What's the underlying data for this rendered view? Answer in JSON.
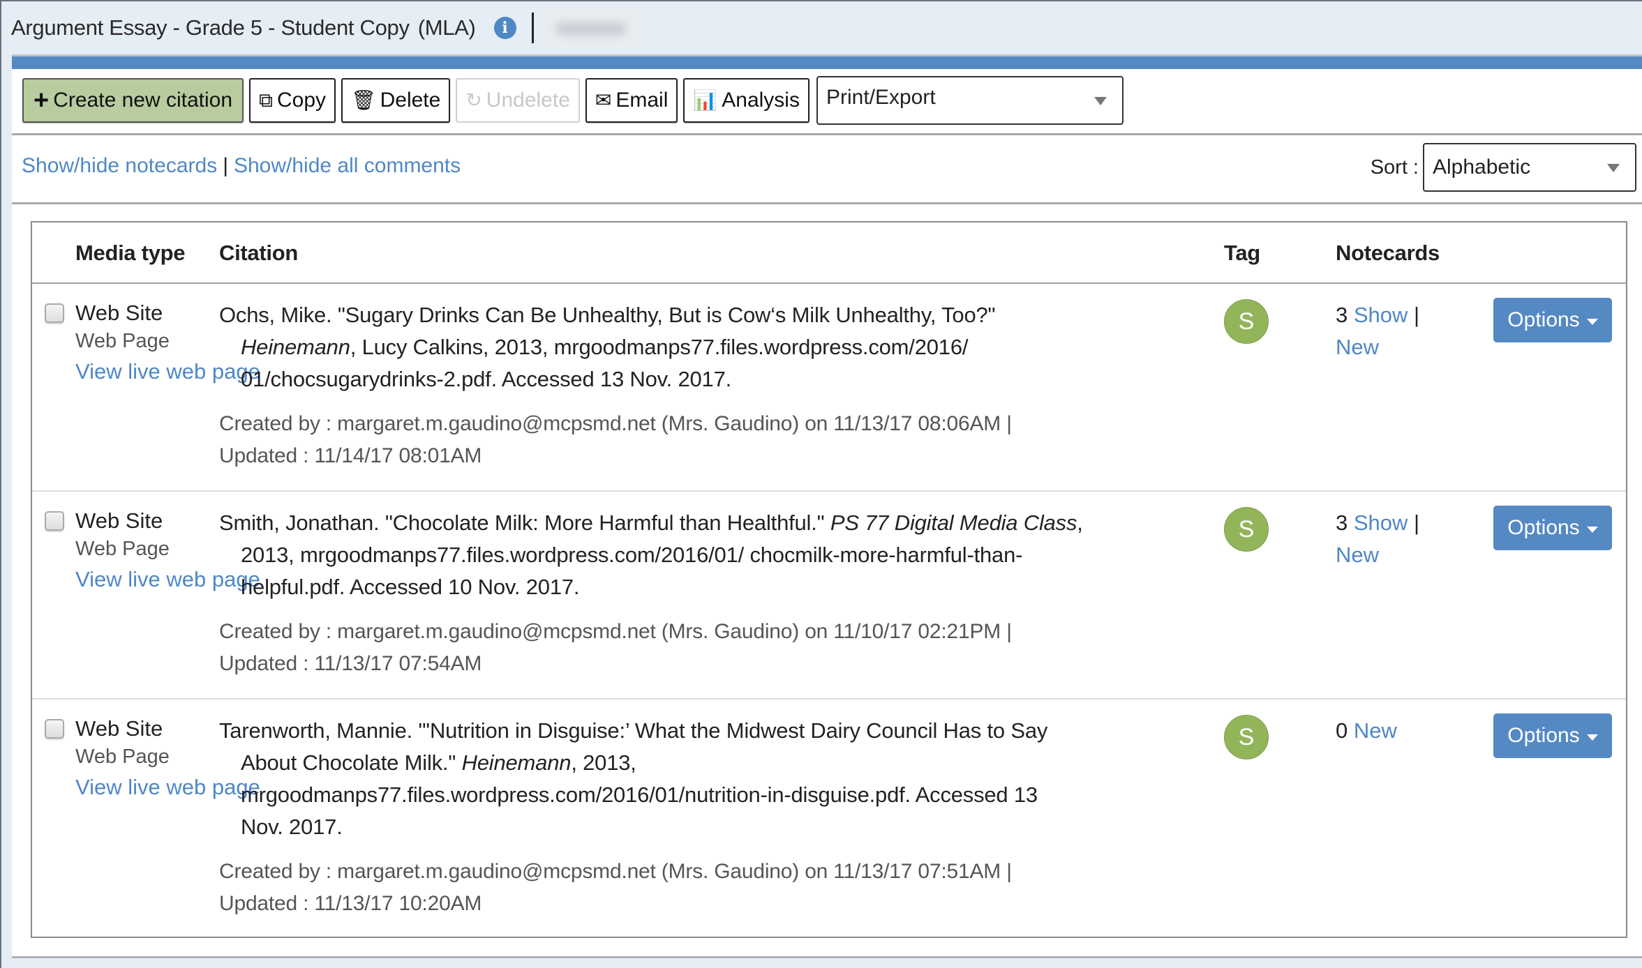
{
  "header": {
    "title": "Argument Essay - Grade 5 - Student Copy",
    "citation_style": "(MLA)",
    "info_icon": "info-icon",
    "user_name_redacted": true
  },
  "toolbar": {
    "create_label": "Create new citation",
    "copy_label": "Copy",
    "delete_label": "Delete",
    "undelete_label": "Undelete",
    "email_label": "Email",
    "analysis_label": "Analysis",
    "print_export": {
      "selected": "Print/Export"
    }
  },
  "links": {
    "notecards": "Show/hide notecards",
    "separator": "|",
    "comments": "Show/hide all comments"
  },
  "sort": {
    "label": "Sort :",
    "selected": "Alphabetic"
  },
  "table": {
    "columns": {
      "media_type": "Media type",
      "citation": "Citation",
      "tag": "Tag",
      "notecards": "Notecards"
    },
    "rows": [
      {
        "checked": false,
        "media_type": "Web Site",
        "sub_type": "Web Page",
        "view_link": "View live web page",
        "citation_pre": "Ochs, Mike. \"Sugary Drinks Can Be Unhealthy, But is Cow‘s Milk Unhealthy, Too?\" ",
        "citation_italic": "Heinemann",
        "citation_post": ", Lucy Calkins, 2013, mrgoodmanps77.files.wordpress.com/2016/ 01/chocsugarydrinks-2.pdf. Accessed 13 Nov. 2017.",
        "created": "Created by : margaret.m.gaudino@mcpsmd.net (Mrs. Gaudino) on 11/13/17 08:06AM |",
        "updated": "Updated : 11/14/17 08:01AM",
        "tag_letter": "S",
        "notecard_count": "3",
        "show_label": "Show",
        "new_label": "New",
        "options_label": "Options"
      },
      {
        "checked": false,
        "media_type": "Web Site",
        "sub_type": "Web Page",
        "view_link": "View live web page",
        "citation_pre": "Smith, Jonathan. \"Chocolate Milk: More Harmful than Healthful.\" ",
        "citation_italic": "PS 77 Digital Media Class",
        "citation_post": ", 2013, mrgoodmanps77.files.wordpress.com/2016/01/ chocmilk-more-harmful-than-helpful.pdf. Accessed 10 Nov. 2017.",
        "created": "Created by : margaret.m.gaudino@mcpsmd.net (Mrs. Gaudino) on 11/10/17 02:21PM |",
        "updated": "Updated : 11/13/17 07:54AM",
        "tag_letter": "S",
        "notecard_count": "3",
        "show_label": "Show",
        "new_label": "New",
        "options_label": "Options"
      },
      {
        "checked": false,
        "media_type": "Web Site",
        "sub_type": "Web Page",
        "view_link": "View live web page",
        "citation_pre": "Tarenworth, Mannie. \"'Nutrition in Disguise:’ What the Midwest Dairy Council Has to Say About Chocolate Milk.\" ",
        "citation_italic": "Heinemann",
        "citation_post": ", 2013, mrgoodmanps77.files.wordpress.com/2016/01/nutrition-in-disguise.pdf. Accessed 13 Nov. 2017.",
        "created": "Created by : margaret.m.gaudino@mcpsmd.net (Mrs. Gaudino) on 11/13/17 07:51AM |",
        "updated": "Updated : 11/13/17 10:20AM",
        "tag_letter": "S",
        "notecard_count": "0",
        "show_label": "",
        "new_label": "New",
        "options_label": "Options"
      }
    ]
  },
  "colors": {
    "accent_blue": "#5589c4",
    "link_blue": "#4f87c7",
    "primary_button_green": "#b8cc9f",
    "tag_green": "#93b55a",
    "header_bg": "#e5edf5"
  }
}
